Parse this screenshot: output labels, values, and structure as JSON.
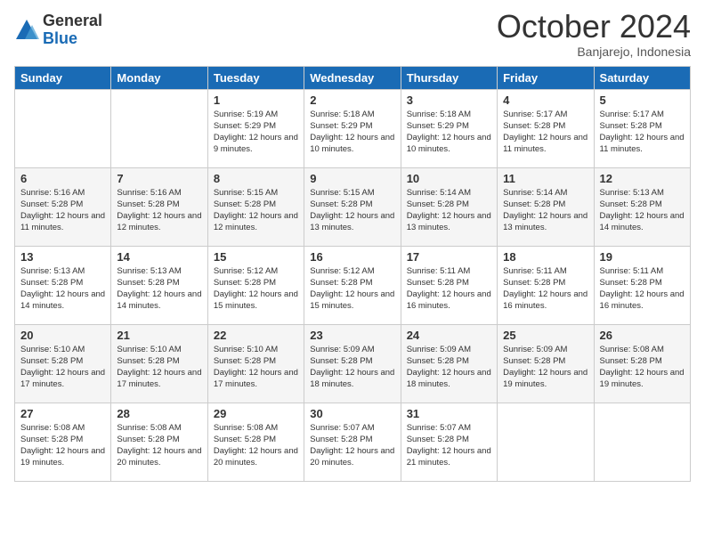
{
  "logo": {
    "general": "General",
    "blue": "Blue"
  },
  "header": {
    "month": "October 2024",
    "location": "Banjarejo, Indonesia"
  },
  "weekdays": [
    "Sunday",
    "Monday",
    "Tuesday",
    "Wednesday",
    "Thursday",
    "Friday",
    "Saturday"
  ],
  "weeks": [
    [
      {
        "day": "",
        "sunrise": "",
        "sunset": "",
        "daylight": ""
      },
      {
        "day": "",
        "sunrise": "",
        "sunset": "",
        "daylight": ""
      },
      {
        "day": "1",
        "sunrise": "Sunrise: 5:19 AM",
        "sunset": "Sunset: 5:29 PM",
        "daylight": "Daylight: 12 hours and 9 minutes."
      },
      {
        "day": "2",
        "sunrise": "Sunrise: 5:18 AM",
        "sunset": "Sunset: 5:29 PM",
        "daylight": "Daylight: 12 hours and 10 minutes."
      },
      {
        "day": "3",
        "sunrise": "Sunrise: 5:18 AM",
        "sunset": "Sunset: 5:29 PM",
        "daylight": "Daylight: 12 hours and 10 minutes."
      },
      {
        "day": "4",
        "sunrise": "Sunrise: 5:17 AM",
        "sunset": "Sunset: 5:28 PM",
        "daylight": "Daylight: 12 hours and 11 minutes."
      },
      {
        "day": "5",
        "sunrise": "Sunrise: 5:17 AM",
        "sunset": "Sunset: 5:28 PM",
        "daylight": "Daylight: 12 hours and 11 minutes."
      }
    ],
    [
      {
        "day": "6",
        "sunrise": "Sunrise: 5:16 AM",
        "sunset": "Sunset: 5:28 PM",
        "daylight": "Daylight: 12 hours and 11 minutes."
      },
      {
        "day": "7",
        "sunrise": "Sunrise: 5:16 AM",
        "sunset": "Sunset: 5:28 PM",
        "daylight": "Daylight: 12 hours and 12 minutes."
      },
      {
        "day": "8",
        "sunrise": "Sunrise: 5:15 AM",
        "sunset": "Sunset: 5:28 PM",
        "daylight": "Daylight: 12 hours and 12 minutes."
      },
      {
        "day": "9",
        "sunrise": "Sunrise: 5:15 AM",
        "sunset": "Sunset: 5:28 PM",
        "daylight": "Daylight: 12 hours and 13 minutes."
      },
      {
        "day": "10",
        "sunrise": "Sunrise: 5:14 AM",
        "sunset": "Sunset: 5:28 PM",
        "daylight": "Daylight: 12 hours and 13 minutes."
      },
      {
        "day": "11",
        "sunrise": "Sunrise: 5:14 AM",
        "sunset": "Sunset: 5:28 PM",
        "daylight": "Daylight: 12 hours and 13 minutes."
      },
      {
        "day": "12",
        "sunrise": "Sunrise: 5:13 AM",
        "sunset": "Sunset: 5:28 PM",
        "daylight": "Daylight: 12 hours and 14 minutes."
      }
    ],
    [
      {
        "day": "13",
        "sunrise": "Sunrise: 5:13 AM",
        "sunset": "Sunset: 5:28 PM",
        "daylight": "Daylight: 12 hours and 14 minutes."
      },
      {
        "day": "14",
        "sunrise": "Sunrise: 5:13 AM",
        "sunset": "Sunset: 5:28 PM",
        "daylight": "Daylight: 12 hours and 14 minutes."
      },
      {
        "day": "15",
        "sunrise": "Sunrise: 5:12 AM",
        "sunset": "Sunset: 5:28 PM",
        "daylight": "Daylight: 12 hours and 15 minutes."
      },
      {
        "day": "16",
        "sunrise": "Sunrise: 5:12 AM",
        "sunset": "Sunset: 5:28 PM",
        "daylight": "Daylight: 12 hours and 15 minutes."
      },
      {
        "day": "17",
        "sunrise": "Sunrise: 5:11 AM",
        "sunset": "Sunset: 5:28 PM",
        "daylight": "Daylight: 12 hours and 16 minutes."
      },
      {
        "day": "18",
        "sunrise": "Sunrise: 5:11 AM",
        "sunset": "Sunset: 5:28 PM",
        "daylight": "Daylight: 12 hours and 16 minutes."
      },
      {
        "day": "19",
        "sunrise": "Sunrise: 5:11 AM",
        "sunset": "Sunset: 5:28 PM",
        "daylight": "Daylight: 12 hours and 16 minutes."
      }
    ],
    [
      {
        "day": "20",
        "sunrise": "Sunrise: 5:10 AM",
        "sunset": "Sunset: 5:28 PM",
        "daylight": "Daylight: 12 hours and 17 minutes."
      },
      {
        "day": "21",
        "sunrise": "Sunrise: 5:10 AM",
        "sunset": "Sunset: 5:28 PM",
        "daylight": "Daylight: 12 hours and 17 minutes."
      },
      {
        "day": "22",
        "sunrise": "Sunrise: 5:10 AM",
        "sunset": "Sunset: 5:28 PM",
        "daylight": "Daylight: 12 hours and 17 minutes."
      },
      {
        "day": "23",
        "sunrise": "Sunrise: 5:09 AM",
        "sunset": "Sunset: 5:28 PM",
        "daylight": "Daylight: 12 hours and 18 minutes."
      },
      {
        "day": "24",
        "sunrise": "Sunrise: 5:09 AM",
        "sunset": "Sunset: 5:28 PM",
        "daylight": "Daylight: 12 hours and 18 minutes."
      },
      {
        "day": "25",
        "sunrise": "Sunrise: 5:09 AM",
        "sunset": "Sunset: 5:28 PM",
        "daylight": "Daylight: 12 hours and 19 minutes."
      },
      {
        "day": "26",
        "sunrise": "Sunrise: 5:08 AM",
        "sunset": "Sunset: 5:28 PM",
        "daylight": "Daylight: 12 hours and 19 minutes."
      }
    ],
    [
      {
        "day": "27",
        "sunrise": "Sunrise: 5:08 AM",
        "sunset": "Sunset: 5:28 PM",
        "daylight": "Daylight: 12 hours and 19 minutes."
      },
      {
        "day": "28",
        "sunrise": "Sunrise: 5:08 AM",
        "sunset": "Sunset: 5:28 PM",
        "daylight": "Daylight: 12 hours and 20 minutes."
      },
      {
        "day": "29",
        "sunrise": "Sunrise: 5:08 AM",
        "sunset": "Sunset: 5:28 PM",
        "daylight": "Daylight: 12 hours and 20 minutes."
      },
      {
        "day": "30",
        "sunrise": "Sunrise: 5:07 AM",
        "sunset": "Sunset: 5:28 PM",
        "daylight": "Daylight: 12 hours and 20 minutes."
      },
      {
        "day": "31",
        "sunrise": "Sunrise: 5:07 AM",
        "sunset": "Sunset: 5:28 PM",
        "daylight": "Daylight: 12 hours and 21 minutes."
      },
      {
        "day": "",
        "sunrise": "",
        "sunset": "",
        "daylight": ""
      },
      {
        "day": "",
        "sunrise": "",
        "sunset": "",
        "daylight": ""
      }
    ]
  ]
}
